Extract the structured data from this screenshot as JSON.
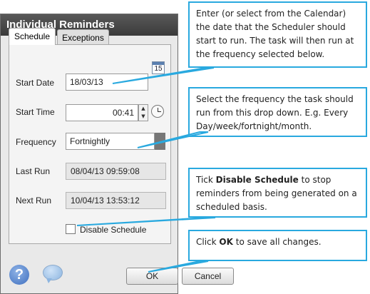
{
  "dialog": {
    "title": "Individual Reminders",
    "tabs": [
      {
        "label": "Schedule"
      },
      {
        "label": "Exceptions"
      }
    ],
    "fields": {
      "start_date": {
        "label": "Start Date",
        "value": "18/03/13"
      },
      "start_time": {
        "label": "Start Time",
        "value": "00:41"
      },
      "frequency": {
        "label": "Frequency",
        "value": "Fortnightly"
      },
      "last_run": {
        "label": "Last Run",
        "value": "08/04/13 09:59:08"
      },
      "next_run": {
        "label": "Next Run",
        "value": "10/04/13 13:53:12"
      }
    },
    "calendar_icon_text": "15",
    "disable_schedule": {
      "label": "Disable Schedule",
      "checked": false
    },
    "help_icon_text": "?",
    "buttons": {
      "ok": "OK",
      "cancel": "Cancel"
    }
  },
  "callouts": {
    "c1": "Enter (or select from the Calendar) the date that the Scheduler should start to run. The task will then run at the frequency selected below.",
    "c2": "Select the frequency the task should run from this drop down. E.g. Every Day/week/fortnight/month.",
    "c3_pre": "Tick ",
    "c3_bold": "Disable Schedule",
    "c3_post": " to stop reminders from being generated on a scheduled basis.",
    "c4_pre": "Click ",
    "c4_bold": "OK",
    "c4_post": " to save all changes."
  },
  "colors": {
    "callout_border": "#29a9df",
    "title_bar": "#3a3a3a"
  }
}
